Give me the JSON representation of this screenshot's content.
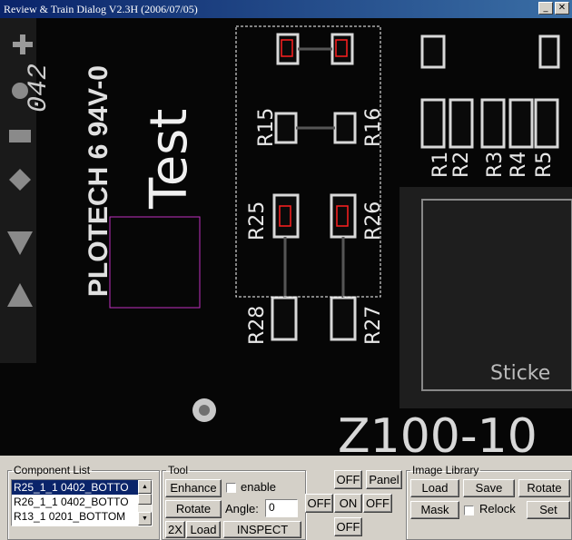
{
  "window": {
    "title": "Review & Train Dialog V2.3H (2006/07/05)"
  },
  "board": {
    "labels": [
      "Test",
      "PLOTECH 6 94V-0",
      "042",
      "R15",
      "R16",
      "R25",
      "R26",
      "R28",
      "R27",
      "R1",
      "R2",
      "R3",
      "R4",
      "R5",
      "Z100-10",
      "Sticke"
    ]
  },
  "component_list": {
    "legend": "Component List",
    "items": [
      "R25_1_1 0402_BOTTO",
      "R26_1_1 0402_BOTTO",
      "R13_1 0201_BOTTOM"
    ],
    "selected": 0
  },
  "tool": {
    "legend": "Tool",
    "enhance": "Enhance",
    "enable": "enable",
    "rotate": "Rotate",
    "angle_label": "Angle:",
    "angle_value": "0",
    "zoom": "2X",
    "load": "Load",
    "inspect": "INSPECT"
  },
  "light": {
    "left": "OFF",
    "top": "OFF",
    "center": "ON",
    "right": "OFF",
    "bottom": "OFF",
    "panel": "Panel"
  },
  "image_library": {
    "legend": "Image Library",
    "load": "Load",
    "save": "Save",
    "rotate": "Rotate",
    "mask": "Mask",
    "relock": "Relock",
    "set": "Set"
  },
  "colors": {
    "title_bar": "#0a246a",
    "selection": "#0a246a",
    "roi_magenta": "#c030c0",
    "pad_red": "#ff2020"
  }
}
